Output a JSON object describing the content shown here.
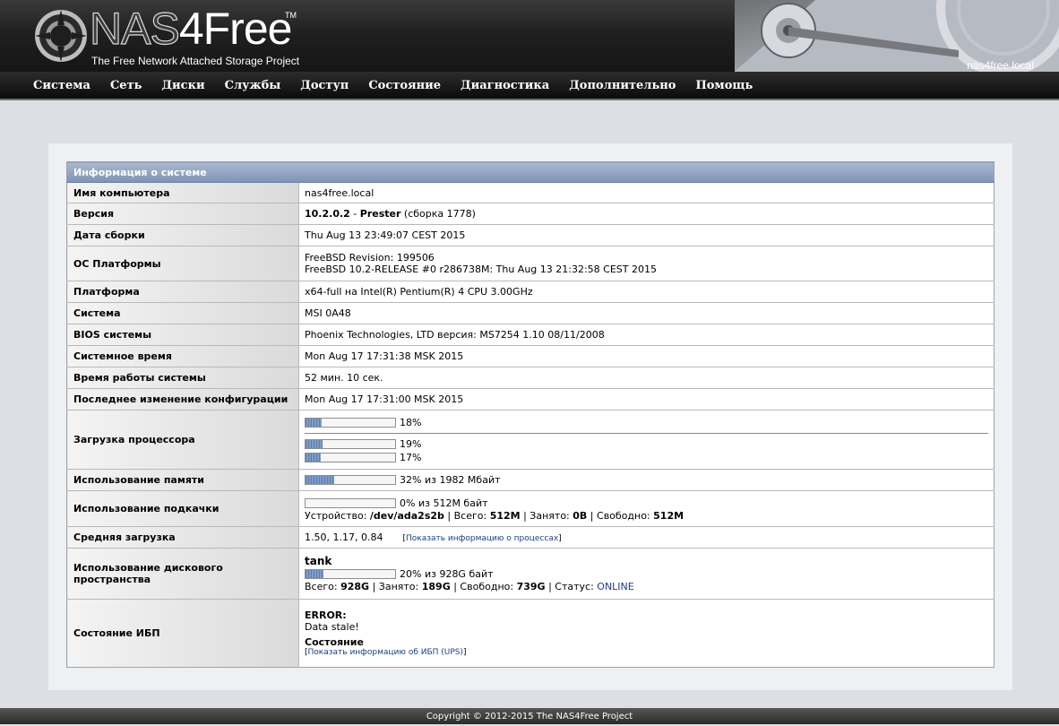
{
  "header": {
    "logo_nas": "NAS",
    "logo_free": "4Free",
    "logo_tm": "TM",
    "tagline": "The Free Network Attached Storage Project",
    "hostname": "nas4free.local"
  },
  "nav": {
    "items": [
      "Система",
      "Сеть",
      "Диски",
      "Службы",
      "Доступ",
      "Состояние",
      "Диагностика",
      "Дополнительно",
      "Помощь"
    ]
  },
  "info": {
    "title": "Информация о системе",
    "rows": {
      "hostname": {
        "label": "Имя компьютера",
        "value": "nas4free.local"
      },
      "version": {
        "label": "Версия",
        "version": "10.2.0.2",
        "dash": " - ",
        "codename": "Prester",
        "build": " (сборка 1778)"
      },
      "build_date": {
        "label": "Дата сборки",
        "value": "Thu Aug 13 23:49:07 CEST 2015"
      },
      "platform_os": {
        "label": "ОС Платформы",
        "line1": "FreeBSD Revision: 199506",
        "line2": "FreeBSD 10.2-RELEASE #0 r286738M: Thu Aug 13 21:32:58 CEST 2015"
      },
      "platform": {
        "label": "Платформа",
        "value": "x64-full на Intel(R) Pentium(R) 4 CPU 3.00GHz"
      },
      "system": {
        "label": "Система",
        "value": "MSI 0A48"
      },
      "bios": {
        "label": "BIOS системы",
        "value": "Phoenix Technologies, LTD версия: MS7254 1.10 08/11/2008"
      },
      "system_time": {
        "label": "Системное время",
        "value": "Mon Aug 17 17:31:38 MSK 2015"
      },
      "uptime": {
        "label": "Время работы системы",
        "value": "52 мин. 10 сек."
      },
      "last_config": {
        "label": "Последнее изменение конфигурации",
        "value": "Mon Aug 17 17:31:00 MSK 2015"
      },
      "cpu_load": {
        "label": "Загрузка процессора",
        "total": {
          "percent": 18,
          "text": "18%"
        },
        "cores": [
          {
            "percent": 19,
            "text": "19%"
          },
          {
            "percent": 17,
            "text": "17%"
          }
        ]
      },
      "memory": {
        "label": "Использование памяти",
        "percent": 32,
        "text": "32% из 1982 Мбайт"
      },
      "swap": {
        "label": "Использование подкачки",
        "percent": 0,
        "text": "0% из 512M байт",
        "device_label": "Устройство: ",
        "device": "/dev/ada2s2b",
        "total_label": " | Всего: ",
        "total": "512M",
        "used_label": " | Занято: ",
        "used": "0B",
        "free_label": " | Свободно: ",
        "free": "512M"
      },
      "load_avg": {
        "label": "Средняя загрузка",
        "value": "1.50, 1.17, 0.84",
        "link": "Показать информацию о процессах"
      },
      "disk": {
        "label": "Использование дискового пространства",
        "pool": "tank",
        "percent": 20,
        "text": "20% из 928G байт",
        "total_label": "Всего: ",
        "total": "928G",
        "used_label": " | Занято: ",
        "used": "189G",
        "free_label": " | Свободно: ",
        "free": "739G",
        "status_label": " | Статус: ",
        "status": "ONLINE"
      },
      "ups": {
        "label": "Состояние ИБП",
        "error_title": "ERROR:",
        "error_text": "Data stale!",
        "state_title": "Состояние",
        "link": "Показать информацию об ИБП (UPS)"
      }
    }
  },
  "footer": {
    "copyright": "Copyright © 2012-2015 The NAS4Free Project"
  }
}
